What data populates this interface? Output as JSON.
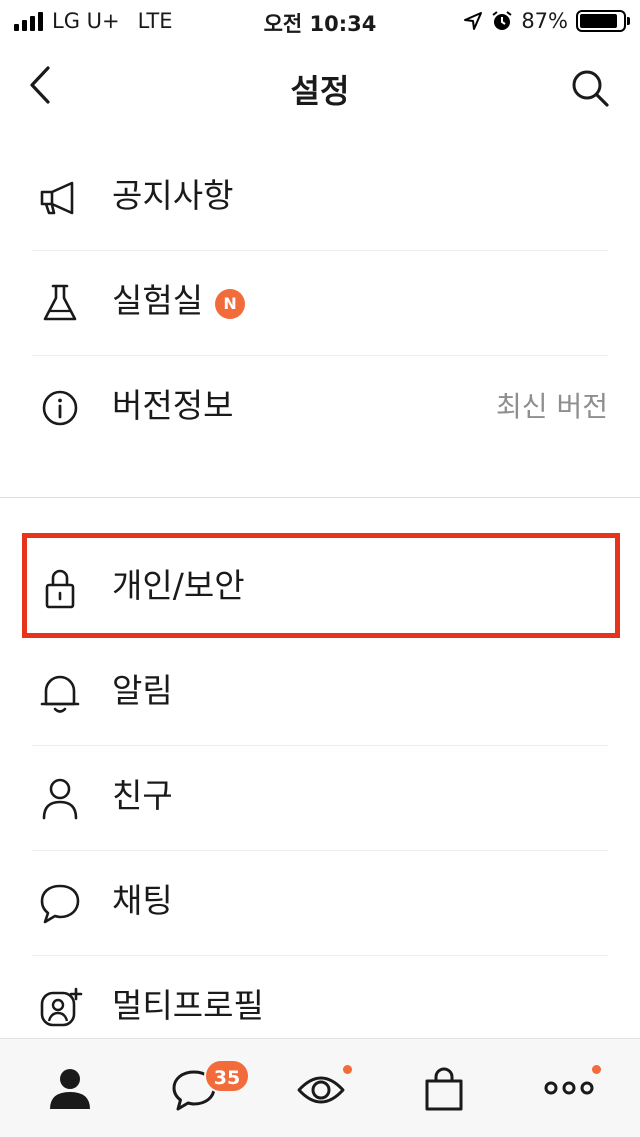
{
  "status_bar": {
    "carrier": "LG U+",
    "network": "LTE",
    "time": "오전 10:34",
    "battery": "87%",
    "battery_level": 0.87
  },
  "nav": {
    "title": "설정",
    "back_icon": "chevron-left-icon",
    "search_icon": "search-icon"
  },
  "section1": [
    {
      "label": "공지사항",
      "icon": "megaphone-icon"
    },
    {
      "label": "실험실",
      "icon": "flask-icon",
      "badge": "N"
    },
    {
      "label": "버전정보",
      "icon": "info-icon",
      "value": "최신 버전"
    }
  ],
  "section2": [
    {
      "label": "개인/보안",
      "icon": "lock-icon"
    },
    {
      "label": "알림",
      "icon": "bell-icon"
    },
    {
      "label": "친구",
      "icon": "person-icon"
    },
    {
      "label": "채팅",
      "icon": "chat-bubble-icon"
    },
    {
      "label": "멀티프로필",
      "icon": "multi-profile-icon"
    }
  ],
  "tab_bar": {
    "tabs": [
      {
        "icon": "friends-icon"
      },
      {
        "icon": "chats-icon",
        "badge": "35"
      },
      {
        "icon": "view-icon",
        "dot": true
      },
      {
        "icon": "shopping-bag-icon"
      },
      {
        "icon": "more-icon",
        "dot": true
      }
    ]
  },
  "colors": {
    "accent": "#f26b3a",
    "highlight_box": "#e8331c",
    "secondary_text": "#8e8e8e"
  }
}
